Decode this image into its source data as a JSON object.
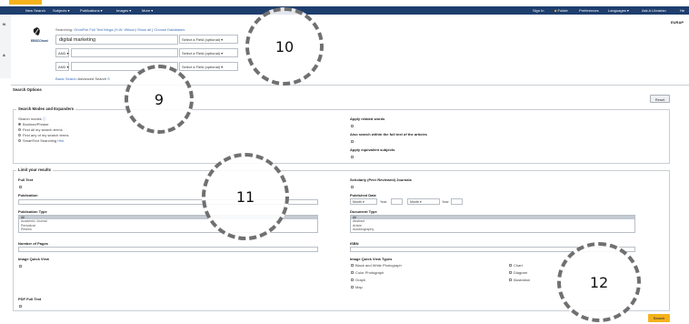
{
  "colors": {
    "toolbar_bg": "#1e3e6e",
    "accent": "#f5b21c",
    "link": "#3a6fb8",
    "annotation": "#707070"
  },
  "toolbar": {
    "left_items": [
      "New Search",
      "Subjects ▾",
      "Publications ▾",
      "Images ▾",
      "More ▾"
    ],
    "right_items": [
      "Sign In",
      "Folder",
      "Preferences",
      "Languages ▾",
      "Ask A Librarian",
      "He"
    ]
  },
  "side_letters": [
    "N",
    "A"
  ],
  "logo_icon": "ebsco-leaf-icon",
  "logo_text": "EBSCOhost",
  "user_tag": "EURAP",
  "search": {
    "searching_label": "Searching:",
    "database": "OmniFile Full Text Mega (H.W. Wilson)",
    "show_all": "Show all",
    "choose_db": "Choose Databases",
    "row1_value": "digital marketing",
    "field_select": "Select a Field (optional) ▾",
    "bool_and": "AND ▾",
    "basic_search": "Basic Search",
    "advanced_search": "Advanced Search",
    "search_history": "S"
  },
  "options": {
    "title": "Search Options",
    "reset": "Reset",
    "modes_title": "Search Modes and Expanders",
    "modes_label": "Search modes",
    "modes": [
      "Boolean/Phrase",
      "Find all my search terms",
      "Find any of my search terms",
      "SmartText Searching"
    ],
    "hint": "Hint",
    "apply_related": "Apply related words",
    "also_search": "Also search within the full text of the articles",
    "apply_equivalent": "Apply equivalent subjects"
  },
  "limits": {
    "title": "Limit your results",
    "full_text": "Full Text",
    "publication": "Publication",
    "pub_type": "Publication Type",
    "pub_types": [
      "All",
      "Academic Journal",
      "Periodical",
      "Review"
    ],
    "num_pages": "Number of Pages",
    "image_quick": "Image Quick View",
    "pdf_full": "PDF Full Text",
    "scholarly": "Scholarly (Peer Reviewed) Journals",
    "published_date": "Published Date",
    "month": "Month",
    "year": "Year:",
    "doc_type": "Document Type",
    "doc_types": [
      "All",
      "Abstract",
      "Article",
      "Autobiography"
    ],
    "isbn": "ISBN",
    "image_types_label": "Image Quick View Types",
    "image_types_left": [
      "Black and White Photograph",
      "Color Photograph",
      "Graph",
      "Map"
    ],
    "image_types_right": [
      "Chart",
      "Diagram",
      "Illustration"
    ]
  },
  "search_button": "Search",
  "annotations": [
    "10",
    "9",
    "11",
    "12"
  ]
}
